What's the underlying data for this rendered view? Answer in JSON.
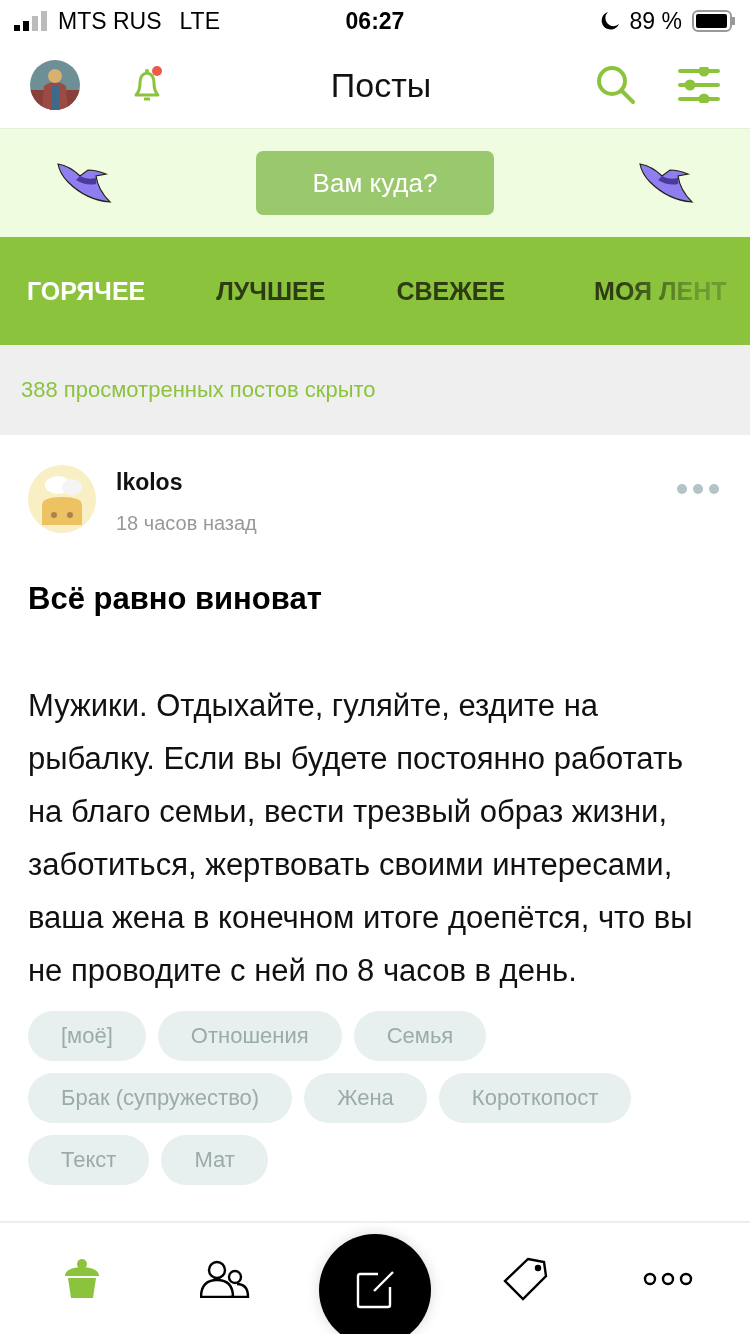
{
  "status_bar": {
    "carrier": "MTS RUS",
    "network": "LTE",
    "time": "06:27",
    "battery": "89 %"
  },
  "header": {
    "title": "Посты",
    "unread_notifications": true
  },
  "banner": {
    "button": "Вам куда?"
  },
  "tabs": [
    {
      "label": "ГОРЯЧЕЕ",
      "selected": true
    },
    {
      "label": "ЛУЧШЕЕ",
      "selected": false
    },
    {
      "label": "СВЕЖЕЕ",
      "selected": false
    },
    {
      "label": "МОЯ ЛЕНТ",
      "selected": false
    }
  ],
  "hidden_notice": "388 просмотренных постов скрыто",
  "post": {
    "author": "lkolos",
    "time": "18 часов назад",
    "title": "Всё равно виноват",
    "body": "Мужики. Отдыхайте, гуляйте, ездите на рыбалку. Если вы будете постоянно работать на благо семьи, вести трезвый образ жизни, заботиться, жертвовать своими интересами, ваша жена в конечном итоге доепётся, что вы не проводите с ней по 8 часов в день.",
    "tags": [
      "[моё]",
      "Отношения",
      "Семья",
      "Брак (супружество)",
      "Жена",
      "Короткопост",
      "Текст",
      "Мат"
    ]
  },
  "bottom_nav": [
    {
      "kind": "home",
      "selected": true
    },
    {
      "kind": "people",
      "selected": false
    },
    {
      "kind": "compose",
      "selected": false
    },
    {
      "kind": "tags",
      "selected": false
    },
    {
      "kind": "more",
      "selected": false
    }
  ]
}
